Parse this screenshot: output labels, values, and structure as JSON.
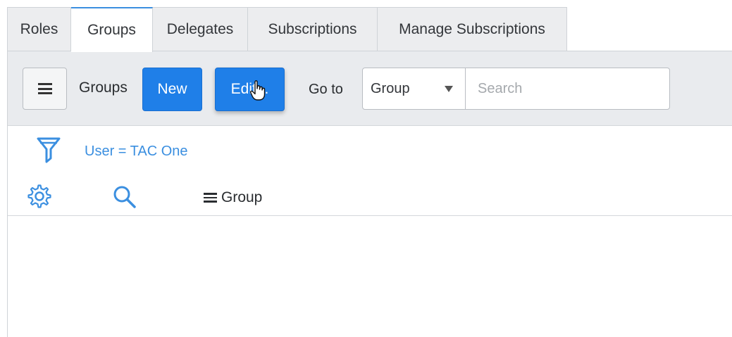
{
  "tabs": [
    {
      "label": "Roles",
      "active": false
    },
    {
      "label": "Groups",
      "active": true
    },
    {
      "label": "Delegates",
      "active": false
    },
    {
      "label": "Subscriptions",
      "active": false
    },
    {
      "label": "Manage Subscriptions",
      "active": false
    }
  ],
  "toolbar": {
    "menu_icon": "hamburger-icon",
    "list_title": "Groups",
    "new_label": "New",
    "edit_label": "Edit...",
    "goto_label": "Go to",
    "goto_select_value": "Group",
    "search_placeholder": "Search"
  },
  "filter": {
    "icon": "funnel-icon",
    "breadcrumb": "User = TAC One"
  },
  "columns": {
    "settings_icon": "gear-icon",
    "search_icon": "search-icon",
    "header_label": "Group"
  },
  "colors": {
    "accent": "#1f7fe8",
    "link": "#3b8fe0",
    "toolbar_bg": "#e9ebee"
  }
}
